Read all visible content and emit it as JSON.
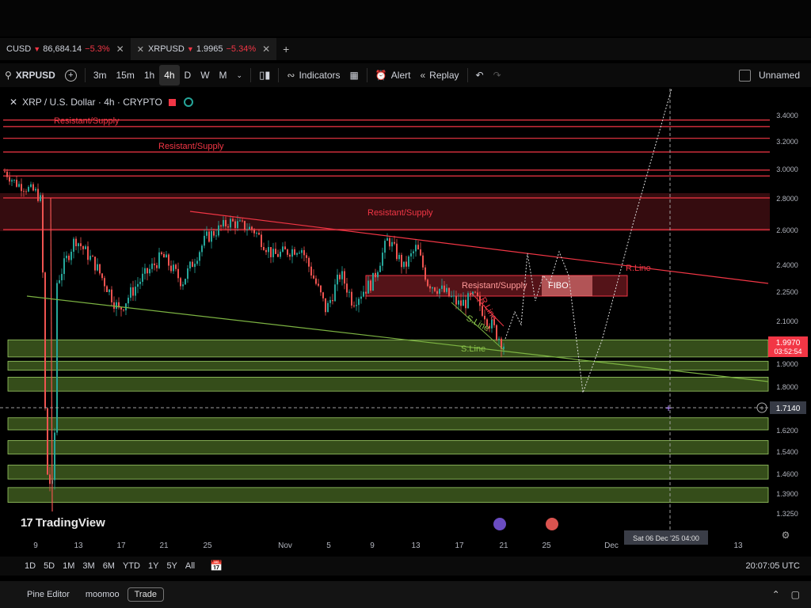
{
  "tabs": [
    {
      "symbol": "CUSD",
      "price": "86,684.14",
      "change": "−5.3%",
      "arrow": "▼",
      "close": "✕"
    },
    {
      "symbol": "XRPUSD",
      "price": "1.9965",
      "change": "−5.34%",
      "arrow": "▼",
      "close": "✕"
    }
  ],
  "toolbar": {
    "symbol": "XRPUSD",
    "intervals": [
      "3m",
      "15m",
      "1h",
      "4h",
      "D",
      "W",
      "M"
    ],
    "selected_interval": "4h",
    "indicators_label": "Indicators",
    "alert_label": "Alert",
    "replay_label": "Replay",
    "layout_name": "Unnamed"
  },
  "legend": {
    "title": "XRP / U.S. Dollar · 4h · CRYPTO"
  },
  "brand": "TradingView",
  "chart_data": {
    "type": "candlestick",
    "price_axis": [
      "3.4000",
      "3.2000",
      "3.0000",
      "2.8000",
      "2.6000",
      "2.4000",
      "2.2500",
      "2.1000",
      "1.9000",
      "1.8000",
      "1.6200",
      "1.5400",
      "1.4600",
      "1.3900",
      "1.3250"
    ],
    "time_axis": [
      "9",
      "13",
      "17",
      "21",
      "25",
      "Nov",
      "5",
      "9",
      "13",
      "17",
      "21",
      "25",
      "Dec",
      "13"
    ],
    "last_price": {
      "value": "1.9970",
      "countdown": "03:52:54",
      "color": "#f23645"
    },
    "crosshair": {
      "price": "1.7140",
      "time": "Sat 06 Dec '25   04:00"
    },
    "annotations": [
      {
        "text": "Resistant/Supply",
        "color": "#f23645"
      },
      {
        "text": "Resistant/Supply",
        "color": "#f23645"
      },
      {
        "text": "Resistant/Supply",
        "color": "#f23645"
      },
      {
        "text": "Resistant/Supply",
        "color": "#ff9999"
      },
      {
        "text": "FIBO",
        "color": "#ffffff"
      },
      {
        "text": "R.Line",
        "color": "#f23645"
      },
      {
        "text": "R.Line",
        "color": "#f23645"
      },
      {
        "text": "S.Line",
        "color": "#8bc34a"
      },
      {
        "text": "S.Line",
        "color": "#8bc34a"
      }
    ],
    "resistance_lines": [
      3.36,
      3.31,
      3.22,
      3.12,
      2.99,
      2.95,
      2.8,
      2.6
    ],
    "support_zones": [
      [
        1.93,
        2.01
      ],
      [
        1.87,
        1.91
      ],
      [
        1.78,
        1.84
      ],
      [
        1.62,
        1.67
      ],
      [
        1.53,
        1.58
      ],
      [
        1.44,
        1.49
      ],
      [
        1.36,
        1.41
      ]
    ],
    "colors": {
      "up": "#26a69a",
      "down": "#ef5350",
      "resistance": "#f23645",
      "support_line": "#7cb342",
      "support_zone": "#3e5a1e"
    },
    "grid": false
  },
  "range_buttons": [
    "1D",
    "5D",
    "1M",
    "3M",
    "6M",
    "YTD",
    "1Y",
    "5Y",
    "All"
  ],
  "clock": "20:07:05 UTC",
  "bottom": {
    "pine_editor": "Pine Editor",
    "broker": "moomoo",
    "trade": "Trade"
  }
}
